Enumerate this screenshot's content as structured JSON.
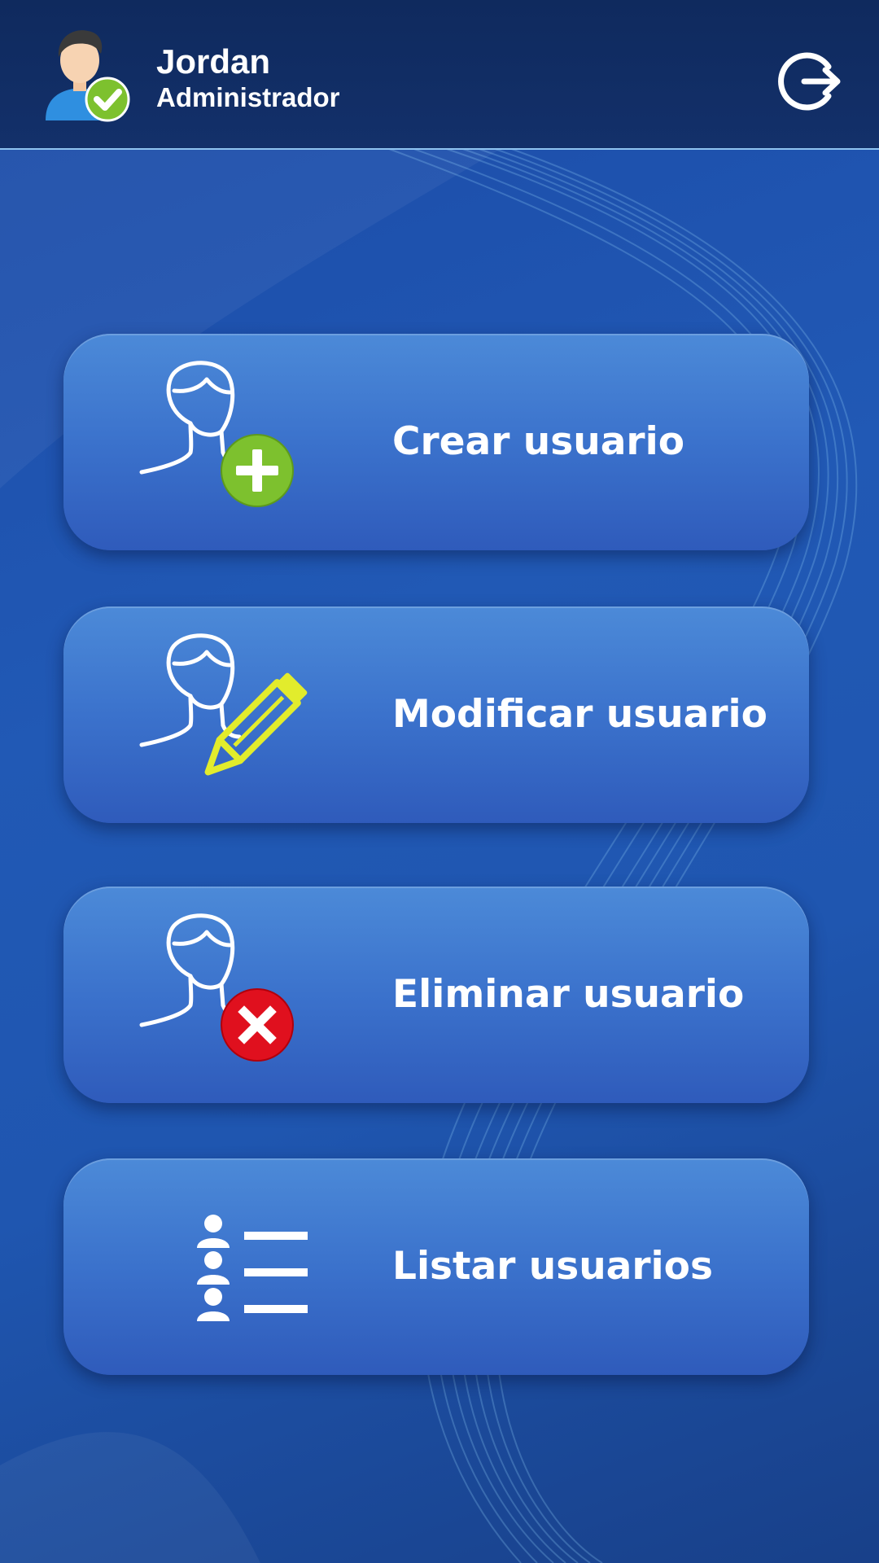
{
  "header": {
    "user_name": "Jordan",
    "user_role": "Administrador",
    "avatar_icon": "user-verified-avatar",
    "logout_icon": "logout-icon"
  },
  "menu": {
    "items": [
      {
        "label": "Crear usuario",
        "icon": "user-add-icon",
        "badge_color": "#7dc12e"
      },
      {
        "label": "Modificar usuario",
        "icon": "user-edit-icon",
        "badge_color": "#e2ec2c"
      },
      {
        "label": "Eliminar usuario",
        "icon": "user-delete-icon",
        "badge_color": "#e0101e"
      },
      {
        "label": "Listar usuarios",
        "icon": "user-list-icon",
        "badge_color": "#ffffff"
      }
    ]
  },
  "colors": {
    "background": "#1f56b0",
    "header": "#0f2a5e",
    "button": "#3b72cc",
    "text": "#ffffff"
  }
}
